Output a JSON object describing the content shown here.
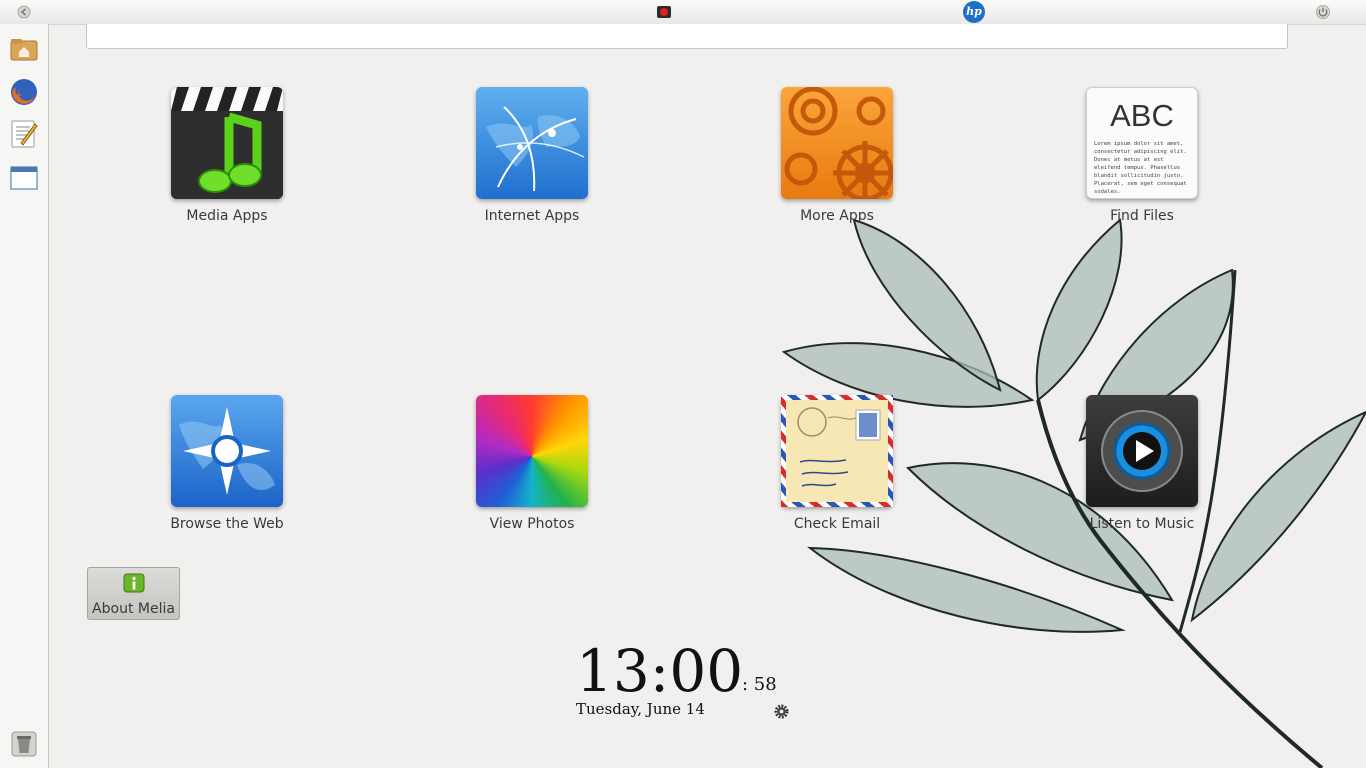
{
  "top_panel": {
    "left_icon": "back-arrow-icon",
    "center_icon": "red-indicator-icon",
    "brand_icon": "hp-logo-icon",
    "brand_text": "hp",
    "right_icon": "power-icon"
  },
  "launcher": {
    "items": [
      "home-folder-icon",
      "firefox-icon",
      "text-editor-icon",
      "window-icon"
    ],
    "trash": "trash-icon"
  },
  "search": {
    "value": "",
    "placeholder": ""
  },
  "apps": [
    {
      "label": "Media Apps",
      "icon": "media-clapper-icon"
    },
    {
      "label": "Internet Apps",
      "icon": "globe-network-icon"
    },
    {
      "label": "More Apps",
      "icon": "gears-icon"
    },
    {
      "label": "Find Files",
      "icon": "document-abc-icon"
    },
    {
      "label": "Browse the Web",
      "icon": "compass-globe-icon"
    },
    {
      "label": "View Photos",
      "icon": "color-wheel-icon"
    },
    {
      "label": "Check Email",
      "icon": "envelope-icon"
    },
    {
      "label": "Listen to Music",
      "icon": "music-player-icon"
    }
  ],
  "find_files_icon_text": {
    "heading": "ABC",
    "body": "Lorem ipsum dolor sit amet, consectetur adipiscing elit. Donec at metus at est eleifend tempus. Phasellus blandit sollicitudin justo. Placerat, sem eget consequat sodales."
  },
  "about": {
    "label": "About Melia",
    "icon": "info-icon"
  },
  "clock": {
    "time": "13:00",
    "seconds": ": 58",
    "date": "Tuesday, June 14",
    "settings_icon": "gear-icon"
  },
  "colors": {
    "background": "#f1f0ee",
    "accent_orange": "#f08a1c",
    "accent_blue": "#2a7fd6"
  }
}
